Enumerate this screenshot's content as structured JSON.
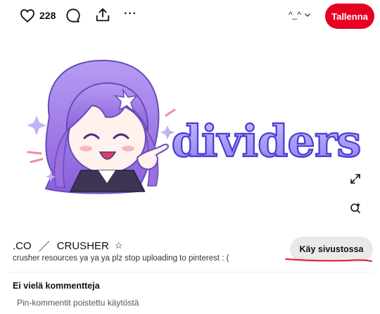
{
  "toolbar": {
    "like_count": "228",
    "more_label": "···",
    "board_name": "^_^",
    "save_label": "Tallenna",
    "icons": [
      "heart-icon",
      "comment-icon",
      "share-icon",
      "more-icon",
      "chevron-down-icon",
      "expand-icon",
      "visual-search-icon"
    ]
  },
  "pin": {
    "image_text": "dividers"
  },
  "source": {
    "site": ".CO",
    "separator": "／",
    "name": "CRUSHER",
    "star": "☆",
    "description": "crusher resources ya ya ya plz stop uploading to pinterest : (",
    "visit_label": "Käy sivustossa"
  },
  "comments": {
    "title": "Ei vielä kommentteja",
    "disabled_text": "Pin-kommentit poistettu käytöstä"
  },
  "colors": {
    "save_red": "#e60023",
    "hair_purple": "#9b6fe0",
    "title_purple": "#8b7df2",
    "underline_red": "#e0182d",
    "visit_bg": "#e9e9e9"
  }
}
